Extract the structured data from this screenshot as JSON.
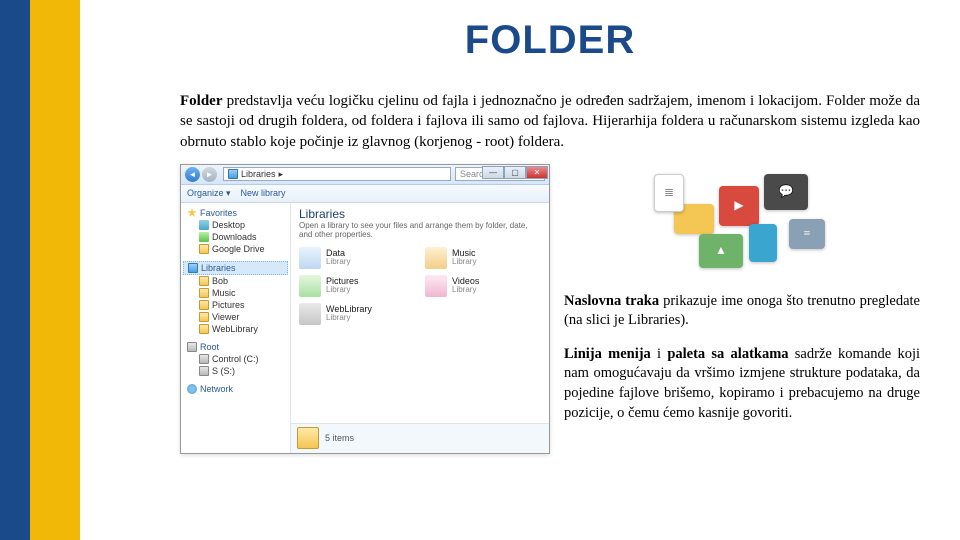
{
  "title": "FOLDER",
  "intro": {
    "bold": "Folder",
    "rest": " predstavlja veću logičku cjelinu od fajla i jednoznačno je određen sadržajem, imenom i lokacijom. Folder može da se sastoji od drugih foldera, od foldera i fajlova ili samo od fajlova. Hijerarhija foldera u računarskom sistemu izgleda kao obrnuto stablo koje počinje iz glavnog (korjenog - root) foldera."
  },
  "explorer": {
    "breadcrumb": "Libraries",
    "search_placeholder": "Search Libraries",
    "toolbar": {
      "organize": "Organize ▾",
      "newlib": "New library"
    },
    "sidebar": {
      "favorites": {
        "label": "Favorites",
        "items": [
          "Desktop",
          "Downloads",
          "Google Drive"
        ]
      },
      "libraries": {
        "label": "Libraries",
        "items": [
          "Bob",
          "Music",
          "Pictures",
          "Viewer",
          "WebLibrary"
        ]
      },
      "root": {
        "label": "Root",
        "items": [
          "Control (C:)",
          "S (S:)"
        ]
      },
      "network": {
        "label": "Network"
      }
    },
    "main": {
      "title": "Libraries",
      "subtitle": "Open a library to see your files and arrange them by folder, date, and other properties.",
      "items": [
        {
          "name": "Data",
          "sub": "Library"
        },
        {
          "name": "Music",
          "sub": "Library"
        },
        {
          "name": "Pictures",
          "sub": "Library"
        },
        {
          "name": "Videos",
          "sub": "Library"
        },
        {
          "name": "WebLibrary",
          "sub": "Library"
        }
      ]
    },
    "status": "5 items"
  },
  "p1": {
    "bold": "Naslovna traka",
    "rest": " prikazuje ime onoga što trenutno pregledate (na slici je Libraries)."
  },
  "p2": {
    "b1": "Linija menija",
    "mid": " i ",
    "b2": "paleta sa alatkama",
    "rest": " sadrže komande koji nam omogućavaju da vršimo izmjene strukture podataka, da pojedine fajlove brišemo, kopiramo i prebacujemo na druge pozicije, o čemu ćemo kasnije govoriti."
  }
}
